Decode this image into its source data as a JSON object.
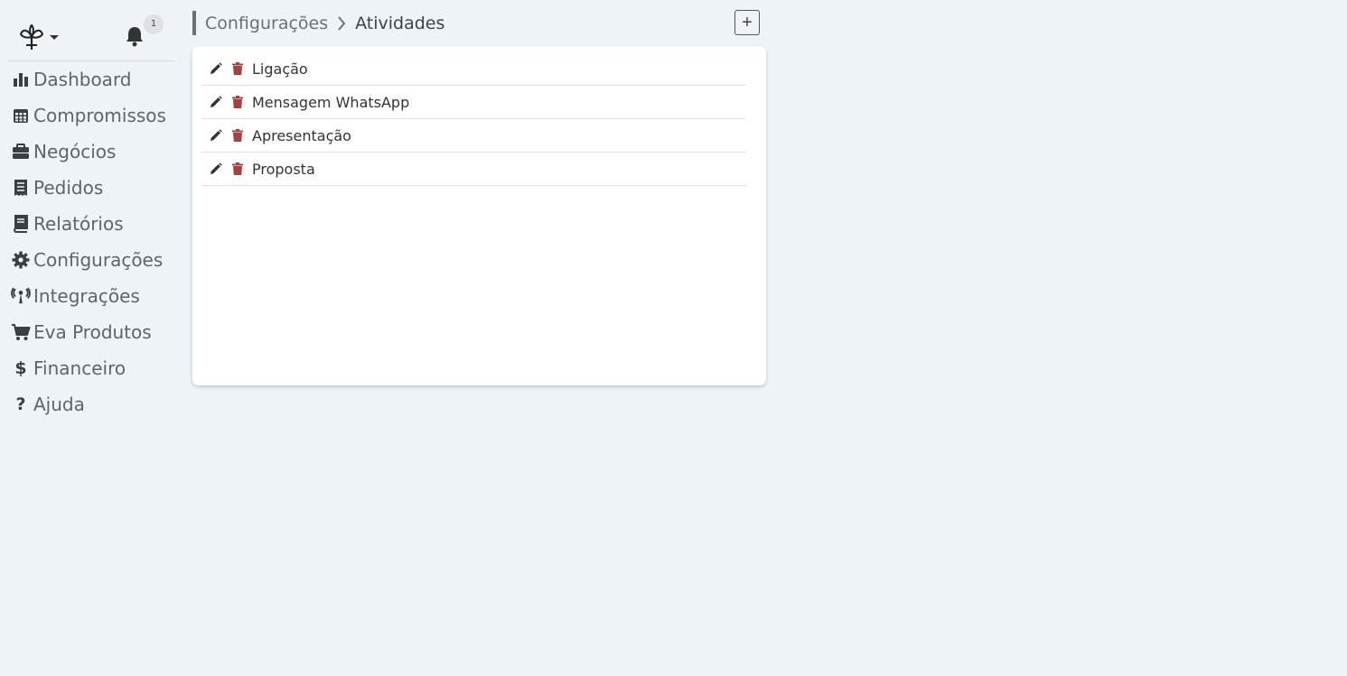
{
  "sidebar": {
    "logo_icon": "sprout-logo-icon",
    "notifications": {
      "icon": "bell-icon",
      "count": "1"
    },
    "items": [
      {
        "label": "Dashboard",
        "icon": "chart-bar-icon"
      },
      {
        "label": "Compromissos",
        "icon": "calendar-icon"
      },
      {
        "label": "Negócios",
        "icon": "briefcase-icon"
      },
      {
        "label": "Pedidos",
        "icon": "receipt-icon"
      },
      {
        "label": "Relatórios",
        "icon": "book-icon"
      },
      {
        "label": "Configurações",
        "icon": "gear-icon"
      },
      {
        "label": "Integrações",
        "icon": "broadcast-tower-icon"
      },
      {
        "label": "Eva Produtos",
        "icon": "shopping-cart-icon"
      },
      {
        "label": "Financeiro",
        "icon": "dollar-icon",
        "glyph": "$"
      },
      {
        "label": "Ajuda",
        "icon": "question-icon",
        "glyph": "?"
      }
    ]
  },
  "breadcrumb": {
    "parent": "Configurações",
    "current": "Atividades"
  },
  "toolbar": {
    "add_label": "+"
  },
  "activities": [
    {
      "name": "Ligação"
    },
    {
      "name": "Mensagem WhatsApp"
    },
    {
      "name": "Apresentação"
    },
    {
      "name": "Proposta"
    }
  ],
  "colors": {
    "background": "#eef3f7",
    "delete_icon": "#a5413f",
    "edit_icon": "#333333",
    "nav_text": "#5f646a"
  }
}
